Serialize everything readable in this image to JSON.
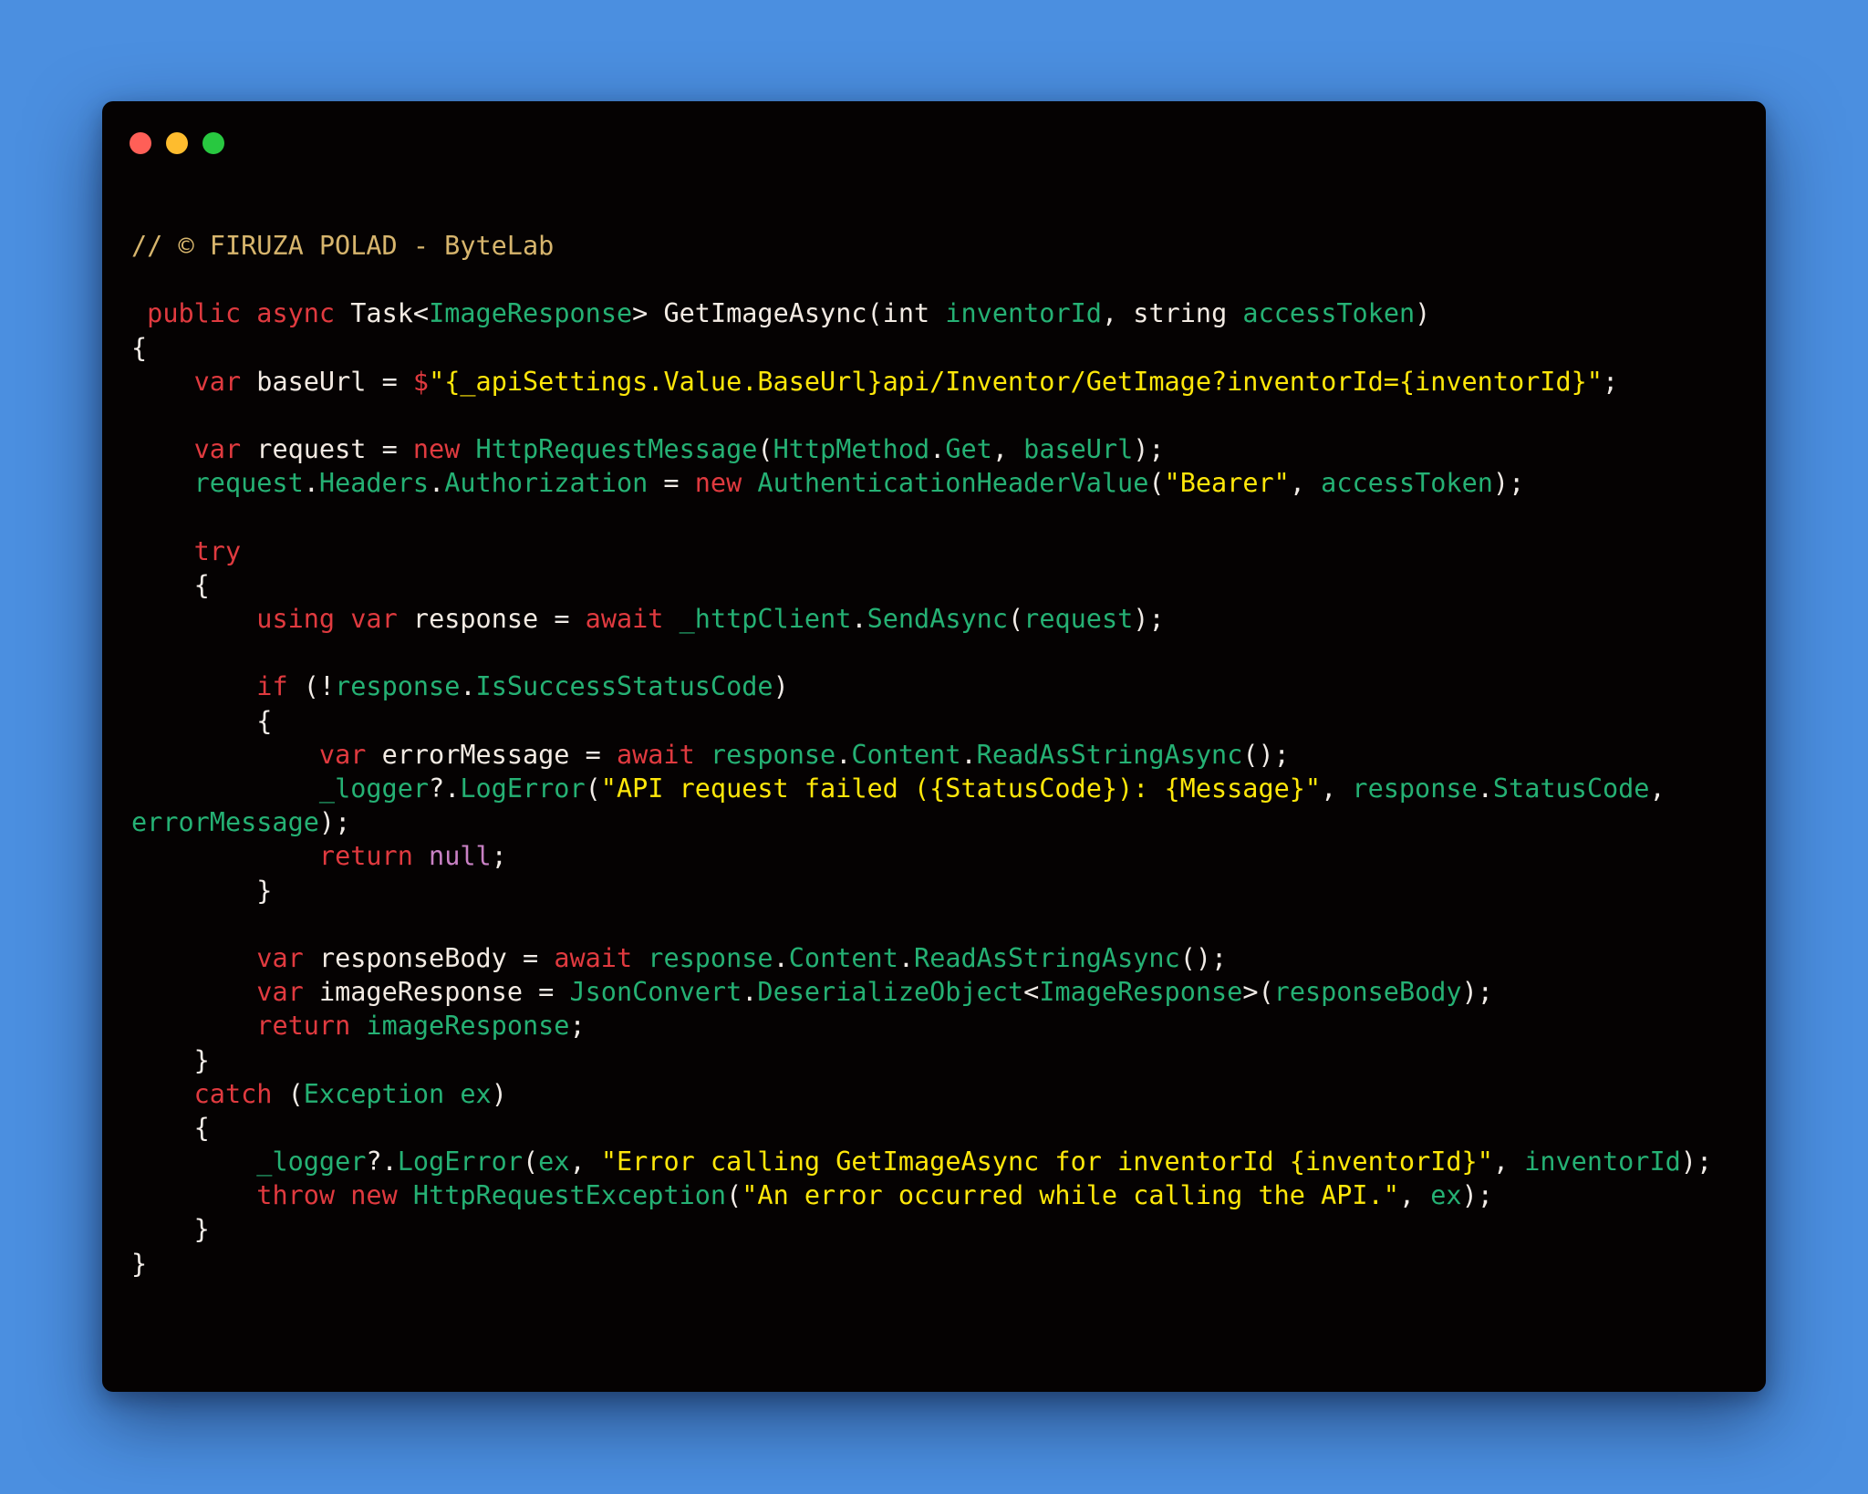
{
  "window": {
    "controls": [
      "close",
      "minimize",
      "zoom"
    ]
  },
  "colors": {
    "background": "#4b8fe0",
    "editor": "#050202",
    "comment": "#d7b56d",
    "keyword": "#e03a3f",
    "type": "#25b174",
    "string": "#ffe70a",
    "null": "#c981c4",
    "text": "#f1ebe6"
  },
  "code": {
    "lines": [
      [
        {
          "t": "comment",
          "v": "// © FIRUZA POLAD - ByteLab"
        }
      ],
      [],
      [
        {
          "t": "punct",
          "v": " "
        },
        {
          "t": "keyword",
          "v": "public"
        },
        {
          "t": "punct",
          "v": " "
        },
        {
          "t": "keyword",
          "v": "async"
        },
        {
          "t": "punct",
          "v": " "
        },
        {
          "t": "ident",
          "v": "Task"
        },
        {
          "t": "punct",
          "v": "<"
        },
        {
          "t": "type",
          "v": "ImageResponse"
        },
        {
          "t": "punct",
          "v": "> "
        },
        {
          "t": "ident",
          "v": "GetImageAsync"
        },
        {
          "t": "punct",
          "v": "("
        },
        {
          "t": "ident",
          "v": "int"
        },
        {
          "t": "punct",
          "v": " "
        },
        {
          "t": "type",
          "v": "inventorId"
        },
        {
          "t": "punct",
          "v": ", "
        },
        {
          "t": "ident",
          "v": "string"
        },
        {
          "t": "punct",
          "v": " "
        },
        {
          "t": "type",
          "v": "accessToken"
        },
        {
          "t": "punct",
          "v": ")"
        }
      ],
      [
        {
          "t": "punct",
          "v": "{"
        }
      ],
      [
        {
          "t": "punct",
          "v": "    "
        },
        {
          "t": "keyword",
          "v": "var"
        },
        {
          "t": "punct",
          "v": " "
        },
        {
          "t": "ident",
          "v": "baseUrl"
        },
        {
          "t": "punct",
          "v": " = "
        },
        {
          "t": "keyword",
          "v": "$"
        },
        {
          "t": "string",
          "v": "\"{_apiSettings.Value.BaseUrl}api/Inventor/GetImage?inventorId={inventorId}\""
        },
        {
          "t": "punct",
          "v": ";"
        }
      ],
      [],
      [
        {
          "t": "punct",
          "v": "    "
        },
        {
          "t": "keyword",
          "v": "var"
        },
        {
          "t": "punct",
          "v": " "
        },
        {
          "t": "ident",
          "v": "request"
        },
        {
          "t": "punct",
          "v": " = "
        },
        {
          "t": "keyword",
          "v": "new"
        },
        {
          "t": "punct",
          "v": " "
        },
        {
          "t": "type",
          "v": "HttpRequestMessage"
        },
        {
          "t": "punct",
          "v": "("
        },
        {
          "t": "type",
          "v": "HttpMethod"
        },
        {
          "t": "punct",
          "v": "."
        },
        {
          "t": "type",
          "v": "Get"
        },
        {
          "t": "punct",
          "v": ", "
        },
        {
          "t": "type",
          "v": "baseUrl"
        },
        {
          "t": "punct",
          "v": ");"
        }
      ],
      [
        {
          "t": "punct",
          "v": "    "
        },
        {
          "t": "type",
          "v": "request"
        },
        {
          "t": "punct",
          "v": "."
        },
        {
          "t": "type",
          "v": "Headers"
        },
        {
          "t": "punct",
          "v": "."
        },
        {
          "t": "type",
          "v": "Authorization"
        },
        {
          "t": "punct",
          "v": " = "
        },
        {
          "t": "keyword",
          "v": "new"
        },
        {
          "t": "punct",
          "v": " "
        },
        {
          "t": "type",
          "v": "AuthenticationHeaderValue"
        },
        {
          "t": "punct",
          "v": "("
        },
        {
          "t": "string",
          "v": "\"Bearer\""
        },
        {
          "t": "punct",
          "v": ", "
        },
        {
          "t": "type",
          "v": "accessToken"
        },
        {
          "t": "punct",
          "v": ");"
        }
      ],
      [],
      [
        {
          "t": "punct",
          "v": "    "
        },
        {
          "t": "keyword",
          "v": "try"
        }
      ],
      [
        {
          "t": "punct",
          "v": "    {"
        }
      ],
      [
        {
          "t": "punct",
          "v": "        "
        },
        {
          "t": "keyword",
          "v": "using"
        },
        {
          "t": "punct",
          "v": " "
        },
        {
          "t": "keyword",
          "v": "var"
        },
        {
          "t": "punct",
          "v": " "
        },
        {
          "t": "ident",
          "v": "response"
        },
        {
          "t": "punct",
          "v": " = "
        },
        {
          "t": "keyword",
          "v": "await"
        },
        {
          "t": "punct",
          "v": " "
        },
        {
          "t": "type",
          "v": "_httpClient"
        },
        {
          "t": "punct",
          "v": "."
        },
        {
          "t": "type",
          "v": "SendAsync"
        },
        {
          "t": "punct",
          "v": "("
        },
        {
          "t": "type",
          "v": "request"
        },
        {
          "t": "punct",
          "v": ");"
        }
      ],
      [],
      [
        {
          "t": "punct",
          "v": "        "
        },
        {
          "t": "keyword",
          "v": "if"
        },
        {
          "t": "punct",
          "v": " (!"
        },
        {
          "t": "type",
          "v": "response"
        },
        {
          "t": "punct",
          "v": "."
        },
        {
          "t": "type",
          "v": "IsSuccessStatusCode"
        },
        {
          "t": "punct",
          "v": ")"
        }
      ],
      [
        {
          "t": "punct",
          "v": "        {"
        }
      ],
      [
        {
          "t": "punct",
          "v": "            "
        },
        {
          "t": "keyword",
          "v": "var"
        },
        {
          "t": "punct",
          "v": " "
        },
        {
          "t": "ident",
          "v": "errorMessage"
        },
        {
          "t": "punct",
          "v": " = "
        },
        {
          "t": "keyword",
          "v": "await"
        },
        {
          "t": "punct",
          "v": " "
        },
        {
          "t": "type",
          "v": "response"
        },
        {
          "t": "punct",
          "v": "."
        },
        {
          "t": "type",
          "v": "Content"
        },
        {
          "t": "punct",
          "v": "."
        },
        {
          "t": "type",
          "v": "ReadAsStringAsync"
        },
        {
          "t": "punct",
          "v": "();"
        }
      ],
      [
        {
          "t": "punct",
          "v": "            "
        },
        {
          "t": "type",
          "v": "_logger"
        },
        {
          "t": "punct",
          "v": "?."
        },
        {
          "t": "type",
          "v": "LogError"
        },
        {
          "t": "punct",
          "v": "("
        },
        {
          "t": "string",
          "v": "\"API request failed ({StatusCode}): {Message}\""
        },
        {
          "t": "punct",
          "v": ", "
        },
        {
          "t": "type",
          "v": "response"
        },
        {
          "t": "punct",
          "v": "."
        },
        {
          "t": "type",
          "v": "StatusCode"
        },
        {
          "t": "punct",
          "v": ","
        }
      ],
      [
        {
          "t": "type",
          "v": "errorMessage"
        },
        {
          "t": "punct",
          "v": ");"
        }
      ],
      [
        {
          "t": "punct",
          "v": "            "
        },
        {
          "t": "keyword",
          "v": "return"
        },
        {
          "t": "punct",
          "v": " "
        },
        {
          "t": "null",
          "v": "null"
        },
        {
          "t": "punct",
          "v": ";"
        }
      ],
      [
        {
          "t": "punct",
          "v": "        }"
        }
      ],
      [],
      [
        {
          "t": "punct",
          "v": "        "
        },
        {
          "t": "keyword",
          "v": "var"
        },
        {
          "t": "punct",
          "v": " "
        },
        {
          "t": "ident",
          "v": "responseBody"
        },
        {
          "t": "punct",
          "v": " = "
        },
        {
          "t": "keyword",
          "v": "await"
        },
        {
          "t": "punct",
          "v": " "
        },
        {
          "t": "type",
          "v": "response"
        },
        {
          "t": "punct",
          "v": "."
        },
        {
          "t": "type",
          "v": "Content"
        },
        {
          "t": "punct",
          "v": "."
        },
        {
          "t": "type",
          "v": "ReadAsStringAsync"
        },
        {
          "t": "punct",
          "v": "();"
        }
      ],
      [
        {
          "t": "punct",
          "v": "        "
        },
        {
          "t": "keyword",
          "v": "var"
        },
        {
          "t": "punct",
          "v": " "
        },
        {
          "t": "ident",
          "v": "imageResponse"
        },
        {
          "t": "punct",
          "v": " = "
        },
        {
          "t": "type",
          "v": "JsonConvert"
        },
        {
          "t": "punct",
          "v": "."
        },
        {
          "t": "type",
          "v": "DeserializeObject"
        },
        {
          "t": "punct",
          "v": "<"
        },
        {
          "t": "type",
          "v": "ImageResponse"
        },
        {
          "t": "punct",
          "v": ">("
        },
        {
          "t": "type",
          "v": "responseBody"
        },
        {
          "t": "punct",
          "v": ");"
        }
      ],
      [
        {
          "t": "punct",
          "v": "        "
        },
        {
          "t": "keyword",
          "v": "return"
        },
        {
          "t": "punct",
          "v": " "
        },
        {
          "t": "type",
          "v": "imageResponse"
        },
        {
          "t": "punct",
          "v": ";"
        }
      ],
      [
        {
          "t": "punct",
          "v": "    }"
        }
      ],
      [
        {
          "t": "punct",
          "v": "    "
        },
        {
          "t": "keyword",
          "v": "catch"
        },
        {
          "t": "punct",
          "v": " ("
        },
        {
          "t": "type",
          "v": "Exception"
        },
        {
          "t": "punct",
          "v": " "
        },
        {
          "t": "type",
          "v": "ex"
        },
        {
          "t": "punct",
          "v": ")"
        }
      ],
      [
        {
          "t": "punct",
          "v": "    {"
        }
      ],
      [
        {
          "t": "punct",
          "v": "        "
        },
        {
          "t": "type",
          "v": "_logger"
        },
        {
          "t": "punct",
          "v": "?."
        },
        {
          "t": "type",
          "v": "LogError"
        },
        {
          "t": "punct",
          "v": "("
        },
        {
          "t": "type",
          "v": "ex"
        },
        {
          "t": "punct",
          "v": ", "
        },
        {
          "t": "string",
          "v": "\"Error calling GetImageAsync for inventorId {inventorId}\""
        },
        {
          "t": "punct",
          "v": ", "
        },
        {
          "t": "type",
          "v": "inventorId"
        },
        {
          "t": "punct",
          "v": ");"
        }
      ],
      [
        {
          "t": "punct",
          "v": "        "
        },
        {
          "t": "keyword",
          "v": "throw"
        },
        {
          "t": "punct",
          "v": " "
        },
        {
          "t": "keyword",
          "v": "new"
        },
        {
          "t": "punct",
          "v": " "
        },
        {
          "t": "type",
          "v": "HttpRequestException"
        },
        {
          "t": "punct",
          "v": "("
        },
        {
          "t": "string",
          "v": "\"An error occurred while calling the API.\""
        },
        {
          "t": "punct",
          "v": ", "
        },
        {
          "t": "type",
          "v": "ex"
        },
        {
          "t": "punct",
          "v": ");"
        }
      ],
      [
        {
          "t": "punct",
          "v": "    }"
        }
      ],
      [
        {
          "t": "punct",
          "v": "}"
        }
      ]
    ]
  }
}
